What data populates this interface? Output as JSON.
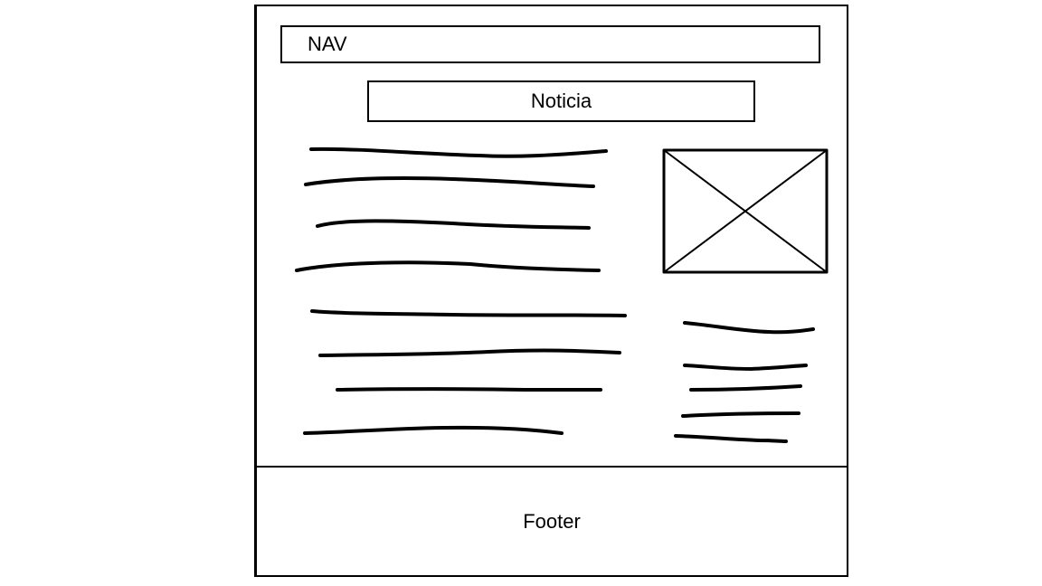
{
  "nav": {
    "label": "NAV"
  },
  "article": {
    "title": "Noticia"
  },
  "footer": {
    "label": "Footer"
  },
  "image_placeholder": {
    "icon": "image-placeholder-icon"
  }
}
